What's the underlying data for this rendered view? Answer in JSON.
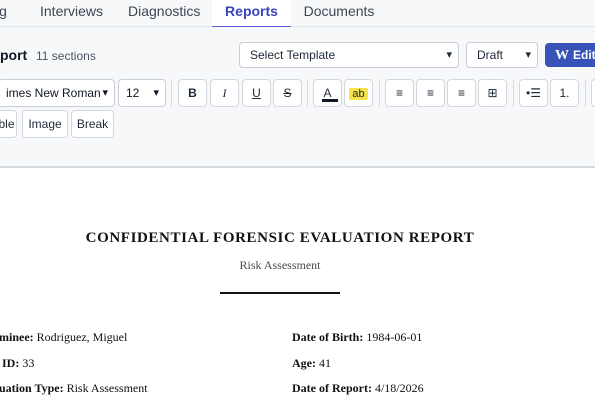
{
  "tabs": [
    {
      "label": "g",
      "active": false
    },
    {
      "label": "Interviews",
      "active": false
    },
    {
      "label": "Diagnostics",
      "active": false
    },
    {
      "label": "Reports",
      "active": true
    },
    {
      "label": "Documents",
      "active": false
    }
  ],
  "header": {
    "title": "port",
    "section_count": "11 sections",
    "template_select": "Select Template",
    "status_select": "Draft",
    "word_button": "Edit",
    "word_glyph": "W"
  },
  "toolbar": {
    "font_family": "imes New Roman",
    "font_size": "12",
    "bold": "B",
    "italic": "I",
    "underline": "U",
    "strike": "S",
    "font_color": "A",
    "highlight": "ab",
    "align_left": "≡",
    "align_center": "≡",
    "align_right": "≡",
    "align_justify": "⊞",
    "bullet_list": "•☰",
    "numbered_list": "1.",
    "insert_table": "ble",
    "insert_image": "Image",
    "insert_break": "Break"
  },
  "document": {
    "title": "CONFIDENTIAL FORENSIC EVALUATION REPORT",
    "subtitle": "Risk Assessment",
    "fields": {
      "examinee_label": "minee:",
      "examinee_value": "Rodriguez, Miguel",
      "dob_label": "Date of Birth:",
      "dob_value": "1984-06-01",
      "id_label": "ID:",
      "id_value": "33",
      "age_label": "Age:",
      "age_value": "41",
      "eval_type_label": "uation Type:",
      "eval_type_value": "Risk Assessment",
      "report_date_label": "Date of Report:",
      "report_date_value": "4/18/2026"
    }
  }
}
